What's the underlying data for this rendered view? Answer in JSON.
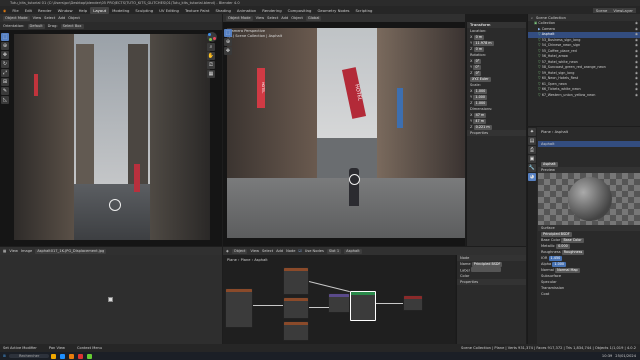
{
  "window": {
    "title": "Tutu_kits_tutorial 01 (C:\\Users\\pc\\Desktop\\blender\\05 PROJECTS\\TUTO_KITS_GLITCHES\\01\\Tutu_kits_tutorial.blend) - Blender 4.0"
  },
  "menu": {
    "items": [
      "File",
      "Edit",
      "Render",
      "Window",
      "Help"
    ],
    "workspaces": [
      "Layout",
      "Modeling",
      "Sculpting",
      "UV Editing",
      "Texture Paint",
      "Shading",
      "Animation",
      "Rendering",
      "Compositing",
      "Geometry Nodes",
      "Scripting"
    ],
    "active_workspace": "Layout",
    "scene": "Scene",
    "view_layer": "ViewLayer"
  },
  "left_viewport": {
    "header": {
      "mode": "Object Mode",
      "view": "View",
      "select": "Select",
      "add": "Add",
      "object": "Object",
      "orientation_label": "Orientation:",
      "orientation": "Default",
      "drag_label": "Drag:",
      "drag": "Select Box"
    },
    "overlay_text": [
      "User Perspective",
      "(1) Scene Collection | Asphalt"
    ]
  },
  "center_viewport": {
    "header": {
      "mode": "Object Mode",
      "view": "View",
      "select": "Select",
      "add": "Add",
      "object": "Object",
      "transform": "Global"
    },
    "overlay_text": [
      "Camera Perspective",
      "(1) Scene Collection | Asphalt"
    ],
    "signs": [
      "HOTEL",
      "HOTEL"
    ]
  },
  "transform_panel": {
    "title": "Transform",
    "location_label": "Location:",
    "rows": [
      {
        "axis": "X",
        "value": "0 m"
      },
      {
        "axis": "Y",
        "value": "11.978 m"
      },
      {
        "axis": "Z",
        "value": "0 m"
      }
    ],
    "rotation_label": "Rotation:",
    "rotation": [
      {
        "axis": "X",
        "value": "0°"
      },
      {
        "axis": "Y",
        "value": "0°"
      },
      {
        "axis": "Z",
        "value": "0°"
      }
    ],
    "rotation_mode": "XYZ Euler",
    "scale_label": "Scale:",
    "scale": [
      {
        "axis": "X",
        "value": "1.000"
      },
      {
        "axis": "Y",
        "value": "1.000"
      },
      {
        "axis": "Z",
        "value": "1.000"
      }
    ],
    "dimensions_label": "Dimensions:",
    "dimensions": [
      {
        "axis": "X",
        "value": "47 m"
      },
      {
        "axis": "Y",
        "value": "47 m"
      },
      {
        "axis": "Z",
        "value": "0.221 m"
      }
    ],
    "properties_label": "Properties"
  },
  "outliner": {
    "title": "Scene Collection",
    "items": [
      {
        "name": "Collection",
        "selected": false
      },
      {
        "name": "Camera",
        "selected": false
      },
      {
        "name": "Asphalt",
        "selected": true
      },
      {
        "name": "53_Business_sign_long",
        "selected": false
      },
      {
        "name": "54_Chinese_neon_sign",
        "selected": false
      },
      {
        "name": "55_Coffee_place_red",
        "selected": false
      },
      {
        "name": "56_Hotel_arrow",
        "selected": false
      },
      {
        "name": "57_Hotel_white_neon",
        "selected": false
      },
      {
        "name": "58_Suncoast_green_red_orange_neon",
        "selected": false
      },
      {
        "name": "59_Hotel_sign_long",
        "selected": false
      },
      {
        "name": "60_Neon_Hotels_Rest",
        "selected": false
      },
      {
        "name": "61_Open_neon",
        "selected": false
      },
      {
        "name": "66_Tickets_white_neon",
        "selected": false
      },
      {
        "name": "67_Western_union_yellow_neon",
        "selected": false
      }
    ]
  },
  "properties": {
    "object_name": "Plane",
    "material_name": "Asphalt",
    "material_slot": "Asphalt",
    "preview_label": "Preview",
    "surface_label": "Surface",
    "surface_shader": "Principled BSDF",
    "base_color_label": "Base Color",
    "base_color_value": "Base Color",
    "metallic_label": "Metallic",
    "metallic_value": "0.000",
    "roughness_label": "Roughness",
    "roughness_value": "Roughness",
    "ior_label": "IOR",
    "ior_value": "1.450",
    "alpha_label": "Alpha",
    "alpha_value": "1.000",
    "normal_label": "Normal",
    "normal_value": "Normal Map",
    "sections": [
      "Subsurface",
      "Specular",
      "Transmission",
      "Coat"
    ]
  },
  "image_editor": {
    "header": {
      "view": "View",
      "image": "Image",
      "filename": "Asphalt017_1K-JPG_Displacement.jpg"
    }
  },
  "node_editor": {
    "header": {
      "object": "Object",
      "view": "View",
      "select": "Select",
      "add": "Add",
      "node": "Node",
      "use_nodes": "Use Nodes",
      "slot": "Slot 1",
      "material": "Asphalt"
    },
    "breadcrumb": [
      "Plane",
      "Plane",
      "Asphalt"
    ],
    "sidebar": {
      "section": "Node",
      "name_label": "Name",
      "name_value": "Principled BSDF",
      "label_label": "Label",
      "label_value": "",
      "color_label": "Color",
      "properties_label": "Properties"
    }
  },
  "statusbar": {
    "left": "Set Active Modifier",
    "middle": "Pan View",
    "right": "Context Menu",
    "stats": "Scene Collection | Plane | Verts 931,374 | Faces 917,372 | Tris 1,834,744 | Objects 1/1,019 | 4.0.2"
  },
  "taskbar": {
    "search_placeholder": "Rechercher",
    "time": "10:39",
    "date": "25/01/2024"
  },
  "colors": {
    "accent": "#5680c2",
    "selection": "#334d80",
    "header": "#303030"
  }
}
